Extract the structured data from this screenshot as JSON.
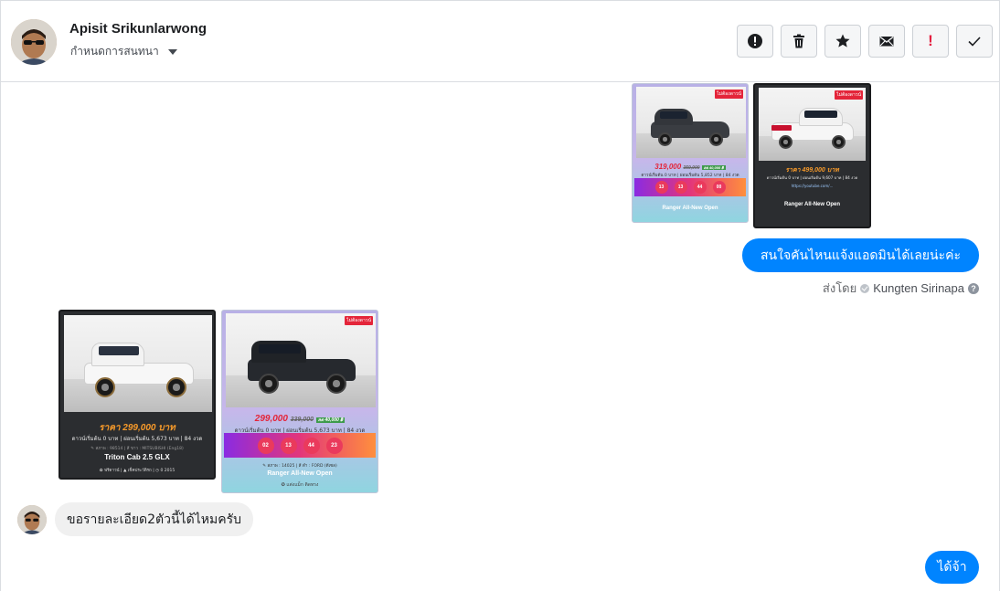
{
  "header": {
    "contact_name": "Apisit Srikunlarwong",
    "assign_label": "กำหนดการสนทนา"
  },
  "toolbar": {
    "icons": [
      "alert-circle-icon",
      "trash-icon",
      "star-icon",
      "envelope-icon",
      "exclamation-icon",
      "checkmark-icon"
    ],
    "exclamation_glyph": "!"
  },
  "thread": {
    "outgoing_cards": [
      {
        "price_main": "319,000",
        "price_old": "359,000",
        "badge": "ลด 40,000 ฿",
        "info": "ดาวน์เริ่มต้น 0 บาท | ผ่อนเริ่มต้น 5,852 บาท | 84 งวด",
        "balls": [
          "13",
          "13",
          "44",
          "00"
        ],
        "model": "Ranger All-New Open",
        "tag": "ไม่ต้องดาวน์"
      },
      {
        "price_main": "ราคา 499,000 บาท",
        "info": "ดาวน์เริ่มต้น 0 บาท | ผ่อนเริ่มต้น 9,607 บาท | 84 งวด",
        "link": "https://youtube.com/...",
        "model": "Ranger All-New Open",
        "tag": "ไม่ต้องดาวน์"
      }
    ],
    "outgoing_message": "สนใจคันไหนแจ้งแอดมินได้เลยน่ะค่ะ",
    "sent_by_prefix": "ส่งโดย",
    "sent_by_agent": "Kungten Sirinapa",
    "help_glyph": "?",
    "incoming_cards": [
      {
        "price_main": "ราคา 299,000 บาท",
        "info": "ดาวน์เริ่มต้น 0 บาท | ผ่อนเริ่มต้น 5,673 บาท | 84 งวด",
        "meta": "✎ สภาพ : 98514 | สี ขาว : MITSUBISHI (Eng18)",
        "model": "Triton Cab 2.5 GLX",
        "footer": "✿ ฟรีดาวน์ | ▲ เช็คประวัติรถ | ◷ 0 2015"
      },
      {
        "price_main": "299,000",
        "price_old": "339,000",
        "badge": "ลด 40,000 ฿",
        "info": "ดาวน์เริ่มต้น 0 บาท | ผ่อนเริ่มต้น 5,673 บาท | 84 งวด",
        "balls": [
          "02",
          "13",
          "44",
          "23"
        ],
        "meta": "✎ สภาพ : 14025 | สี ดำ : FORD (ดีเซล)",
        "model": "Ranger All-New Open",
        "footer": "✪ แต่งแม็ก ติดทรง",
        "tag": "ไม่ต้องดาวน์"
      }
    ],
    "incoming_message": "ขอรายละเอียด2ตัวนี้ได้ไหมครับ",
    "reply_message": "ได้จ้า"
  },
  "colors": {
    "messenger_blue": "#0084ff",
    "incoming_bg": "#f0f0f0",
    "price_red": "#e4253a",
    "price_orange": "#f79a2a"
  }
}
